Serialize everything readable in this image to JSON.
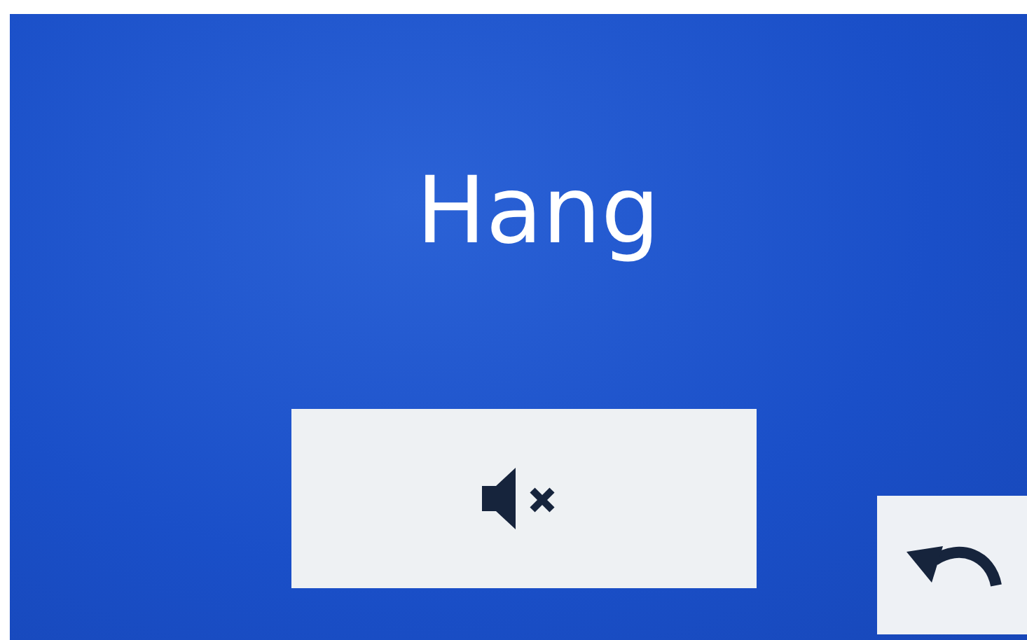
{
  "screen": {
    "title": "Hang"
  },
  "buttons": [
    {
      "kind": "mute",
      "muted": true
    },
    {
      "kind": "back"
    }
  ]
}
